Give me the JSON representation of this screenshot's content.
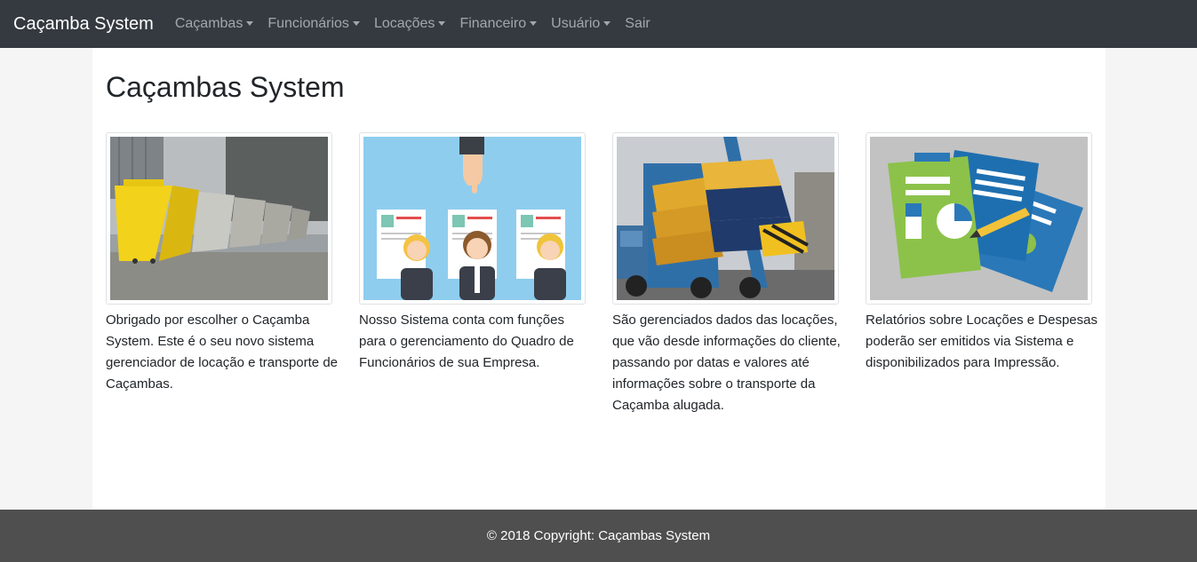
{
  "navbar": {
    "brand": "Caçamba System",
    "items": [
      {
        "label": "Caçambas",
        "dropdown": true
      },
      {
        "label": "Funcionários",
        "dropdown": true
      },
      {
        "label": "Locações",
        "dropdown": true
      },
      {
        "label": "Financeiro",
        "dropdown": true
      },
      {
        "label": "Usuário",
        "dropdown": true
      },
      {
        "label": "Sair",
        "dropdown": false
      }
    ]
  },
  "main": {
    "title": "Caçambas System",
    "cards": [
      {
        "image": "yellow-dumpsters-photo",
        "text": "Obrigado por escolher o Caçamba System. Este é o seu novo sistema gerenciador de locação e transporte de Caçambas."
      },
      {
        "image": "employees-illustration",
        "text": "Nosso Sistema conta com funções para o gerenciamento do Quadro de Funcionários de sua Empresa."
      },
      {
        "image": "dumpster-truck-photo",
        "text": "São gerenciados dados das locações, que vão desde informações do cliente, passando por datas e valores até informações sobre o transporte da Caçamba alugada."
      },
      {
        "image": "reports-illustration",
        "text": "Relatórios sobre Locações e Despesas poderão ser emitidos via Sistema e disponibilizados para Impressão."
      }
    ]
  },
  "footer": {
    "text": "© 2018 Copyright: Caçambas System"
  },
  "colors": {
    "navbar_bg": "#343a40",
    "footer_bg": "#4f4f4f",
    "page_bg": "#f5f5f5"
  }
}
